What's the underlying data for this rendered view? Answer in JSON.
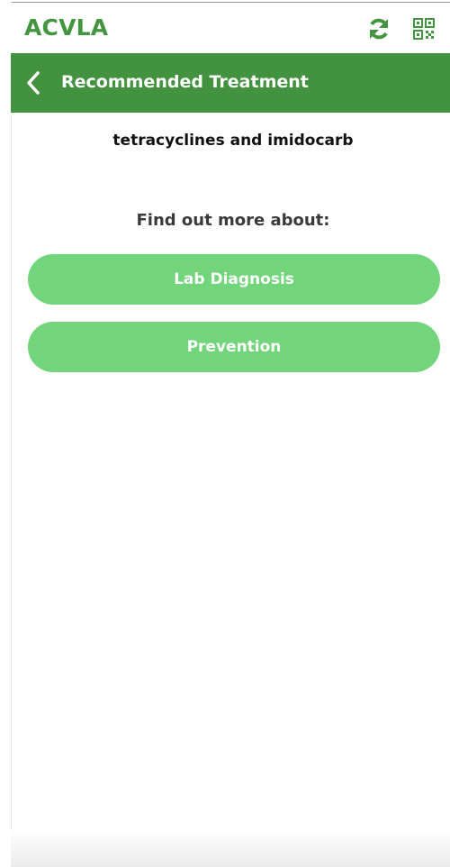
{
  "header": {
    "app_title": "ACVLA",
    "icons": {
      "refresh": "refresh-icon",
      "qr": "qr-code-icon"
    }
  },
  "nav": {
    "back_icon": "chevron-left-icon",
    "title": "Recommended Treatment"
  },
  "content": {
    "treatment": "tetracyclines and imidocarb",
    "find_more_label": "Find out more about:",
    "buttons": [
      {
        "label": "Lab Diagnosis"
      },
      {
        "label": "Prevention"
      }
    ]
  },
  "colors": {
    "brand_green": "#43963f",
    "nav_green": "#43923f",
    "button_green": "#72d57b"
  }
}
